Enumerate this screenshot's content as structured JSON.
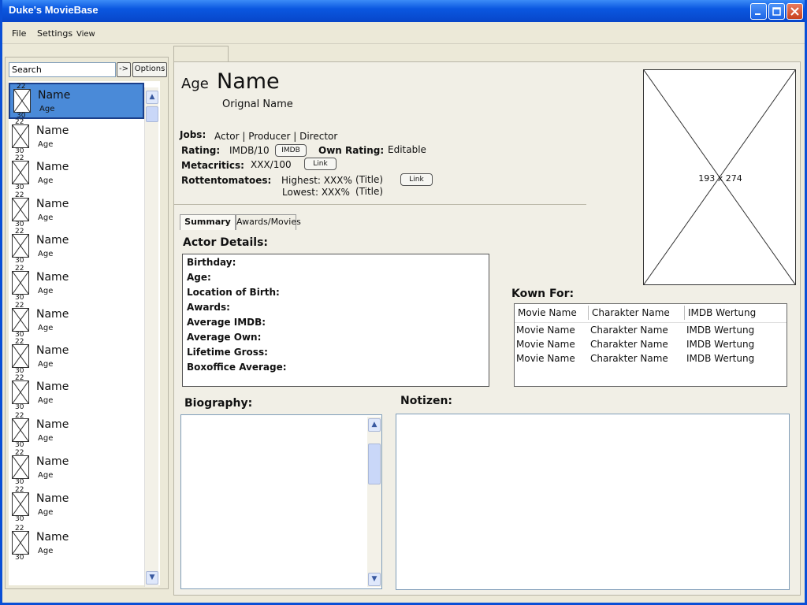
{
  "window": {
    "title": "Duke's MovieBase"
  },
  "menu": {
    "file": "File",
    "settings": "Settings",
    "view": "View"
  },
  "sidebar": {
    "search_value": "Search",
    "go_label": "->",
    "options_label": "Options",
    "items": [
      {
        "name": "Name",
        "age": "Age",
        "top_num": "22",
        "bottom_num": "30",
        "selected": true
      },
      {
        "name": "Name",
        "age": "Age",
        "top_num": "22",
        "bottom_num": "30"
      },
      {
        "name": "Name",
        "age": "Age",
        "top_num": "22",
        "bottom_num": "30"
      },
      {
        "name": "Name",
        "age": "Age",
        "top_num": "22",
        "bottom_num": "30"
      },
      {
        "name": "Name",
        "age": "Age",
        "top_num": "22",
        "bottom_num": "30"
      },
      {
        "name": "Name",
        "age": "Age",
        "top_num": "22",
        "bottom_num": "30"
      },
      {
        "name": "Name",
        "age": "Age",
        "top_num": "22",
        "bottom_num": "30"
      },
      {
        "name": "Name",
        "age": "Age",
        "top_num": "22",
        "bottom_num": "30"
      },
      {
        "name": "Name",
        "age": "Age",
        "top_num": "22",
        "bottom_num": "30"
      },
      {
        "name": "Name",
        "age": "Age",
        "top_num": "22",
        "bottom_num": "30"
      },
      {
        "name": "Name",
        "age": "Age",
        "top_num": "22",
        "bottom_num": "30"
      },
      {
        "name": "Name",
        "age": "Age",
        "top_num": "22",
        "bottom_num": "30"
      },
      {
        "name": "Name",
        "age": "Age",
        "top_num": "22",
        "bottom_num": "30"
      }
    ]
  },
  "header": {
    "age": "Age",
    "name": "Name",
    "original_name": "Orignal Name",
    "jobs_label": "Jobs:",
    "jobs": "Actor  |  Producer  |  Director",
    "rating_label": "Rating:",
    "rating_value": "IMDB/10",
    "imdb_button": "IMDB",
    "own_rating_label": "Own Rating:",
    "own_rating_value": "Editable",
    "metacritics_label": "Metacritics:",
    "metacritics_value": "XXX/100",
    "metacritics_link": "Link",
    "rotten_label": "Rottentomatoes:",
    "rotten_highest": "Highest: XXX%",
    "rotten_highest_title": "(Title)",
    "rotten_lowest": "Lowest: XXX%",
    "rotten_lowest_title": "(Title)",
    "rotten_link": "Link"
  },
  "poster": {
    "label": "193 x 274"
  },
  "tabs": {
    "summary": "Summary",
    "awards": "Awards/Movies"
  },
  "actor_details": {
    "title": "Actor Details:",
    "rows": [
      "Birthday:",
      "Age:",
      "Location of Birth:",
      "Awards:",
      "Average IMDB:",
      "Average Own:",
      "Lifetime Gross:",
      "Boxoffice Average:"
    ]
  },
  "known_for": {
    "title": "Kown For:",
    "columns": [
      "Movie Name",
      "Charakter Name",
      "IMDB Wertung"
    ],
    "rows": [
      [
        "Movie Name",
        "Charakter Name",
        "IMDB Wertung"
      ],
      [
        "Movie Name",
        "Charakter Name",
        "IMDB Wertung"
      ],
      [
        "Movie Name",
        "Charakter Name",
        "IMDB Wertung"
      ]
    ]
  },
  "biography": {
    "title": "Biography:"
  },
  "notes": {
    "title": "Notizen:"
  }
}
